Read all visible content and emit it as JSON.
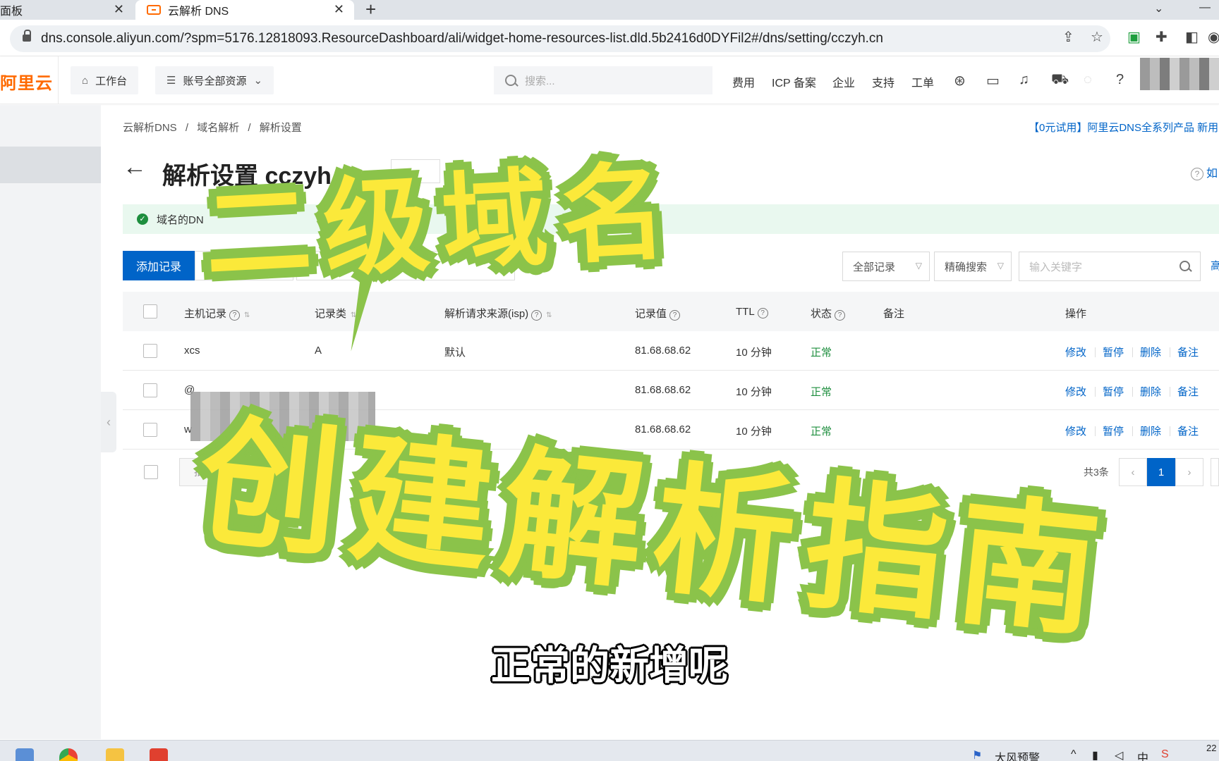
{
  "browser": {
    "tabs": [
      {
        "label": "面板"
      },
      {
        "label": "云解析 DNS"
      }
    ],
    "new_tab": "+",
    "close_glyph": "✕",
    "url": "dns.console.aliyun.com/?spm=5176.12818093.ResourceDashboard/ali/widget-home-resources-list.dld.5b2416d0DYFil2#/dns/setting/cczyh.cn"
  },
  "topnav": {
    "logo": "阿里云",
    "workbench": "工作台",
    "account_resources": "账号全部资源",
    "search_placeholder": "搜索...",
    "links": [
      "费用",
      "ICP 备案",
      "企业",
      "支持",
      "工单"
    ]
  },
  "page": {
    "breadcrumb": [
      "云解析DNS",
      "域名解析",
      "解析设置"
    ],
    "promo": "【0元试用】阿里云DNS全系列产品 新用",
    "title": "解析设置 cczyh",
    "help": "如",
    "notice": "域名的DN"
  },
  "toolbar": {
    "add_record": "添加记录",
    "filter_all": "全部记录",
    "filter_mode": "精确搜索",
    "keyword_placeholder": "输入关键字",
    "advanced": "高"
  },
  "table": {
    "columns": {
      "host": "主机记录",
      "type": "记录类",
      "isp": "解析请求来源(isp)",
      "value": "记录值",
      "ttl": "TTL",
      "status": "状态",
      "remark": "备注",
      "ops": "操作"
    },
    "rows": [
      {
        "host": "xcs",
        "type": "A",
        "isp": "默认",
        "value": "81.68.68.62",
        "ttl": "10 分钟",
        "status": "正常"
      },
      {
        "host": "@",
        "type": "",
        "isp": "",
        "value": "81.68.68.62",
        "ttl": "10 分钟",
        "status": "正常"
      },
      {
        "host": "w",
        "type": "",
        "isp": "",
        "value": "81.68.68.62",
        "ttl": "10 分钟",
        "status": "正常"
      }
    ],
    "row_ops": [
      "修改",
      "暂停",
      "删除",
      "备注"
    ],
    "batch": "批量",
    "total": "共3条",
    "page_current": "1"
  },
  "overlay": {
    "line1": "二级域名",
    "line2": "创建解析指南",
    "subtitle": "正常的新增呢"
  },
  "taskbar": {
    "weather": "大风预警",
    "clock": "22"
  },
  "colors": {
    "brand_orange": "#ff6a00",
    "primary_blue": "#0064c8",
    "status_green": "#1e8e3e",
    "overlay_yellow": "#fbe93a",
    "overlay_green": "#8bc34a"
  }
}
